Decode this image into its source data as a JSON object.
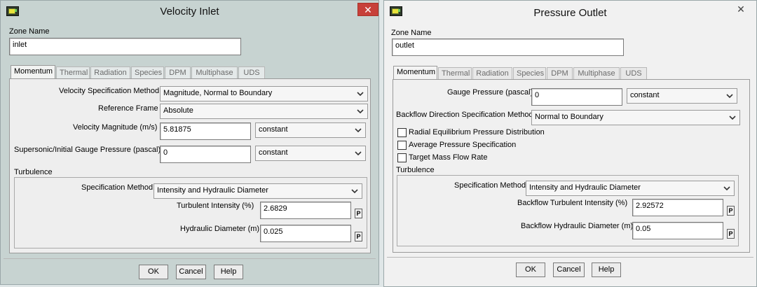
{
  "velocity_inlet": {
    "title": "Velocity Inlet",
    "close": "✕",
    "zone_name_label": "Zone Name",
    "zone_name": "inlet",
    "tabs": [
      "Momentum",
      "Thermal",
      "Radiation",
      "Species",
      "DPM",
      "Multiphase",
      "UDS"
    ],
    "velocity_spec_label": "Velocity Specification Method",
    "velocity_spec": "Magnitude, Normal to Boundary",
    "reference_frame_label": "Reference Frame",
    "reference_frame": "Absolute",
    "velocity_magnitude_label": "Velocity Magnitude (m/s)",
    "velocity_magnitude": "5.81875",
    "velocity_magnitude_profile": "constant",
    "gauge_pressure_label": "Supersonic/Initial Gauge Pressure (pascal)",
    "gauge_pressure": "0",
    "gauge_pressure_profile": "constant",
    "turbulence_label": "Turbulence",
    "spec_method_label": "Specification Method",
    "spec_method": "Intensity and Hydraulic Diameter",
    "turb_intensity_label": "Turbulent Intensity (%)",
    "turb_intensity": "2.6829",
    "hydraulic_diameter_label": "Hydraulic Diameter (m)",
    "hydraulic_diameter": "0.025",
    "p": "P",
    "ok": "OK",
    "cancel": "Cancel",
    "help": "Help"
  },
  "pressure_outlet": {
    "title": "Pressure Outlet",
    "close": "✕",
    "zone_name_label": "Zone Name",
    "zone_name": "outlet",
    "tabs": [
      "Momentum",
      "Thermal",
      "Radiation",
      "Species",
      "DPM",
      "Multiphase",
      "UDS"
    ],
    "gauge_pressure_label": "Gauge Pressure (pascal)",
    "gauge_pressure": "0",
    "gauge_pressure_profile": "constant",
    "backflow_dir_label": "Backflow Direction Specification Method",
    "backflow_dir": "Normal to Boundary",
    "radial_eq_label": "Radial Equilibrium Pressure Distribution",
    "avg_pressure_label": "Average Pressure Specification",
    "target_mass_label": "Target Mass Flow Rate",
    "turbulence_label": "Turbulence",
    "spec_method_label": "Specification Method",
    "spec_method": "Intensity and Hydraulic Diameter",
    "bf_turb_intensity_label": "Backflow Turbulent Intensity (%)",
    "bf_turb_intensity": "2.92572",
    "bf_hydraulic_diameter_label": "Backflow Hydraulic Diameter (m)",
    "bf_hydraulic_diameter": "0.05",
    "p": "P",
    "ok": "OK",
    "cancel": "Cancel",
    "help": "Help"
  }
}
